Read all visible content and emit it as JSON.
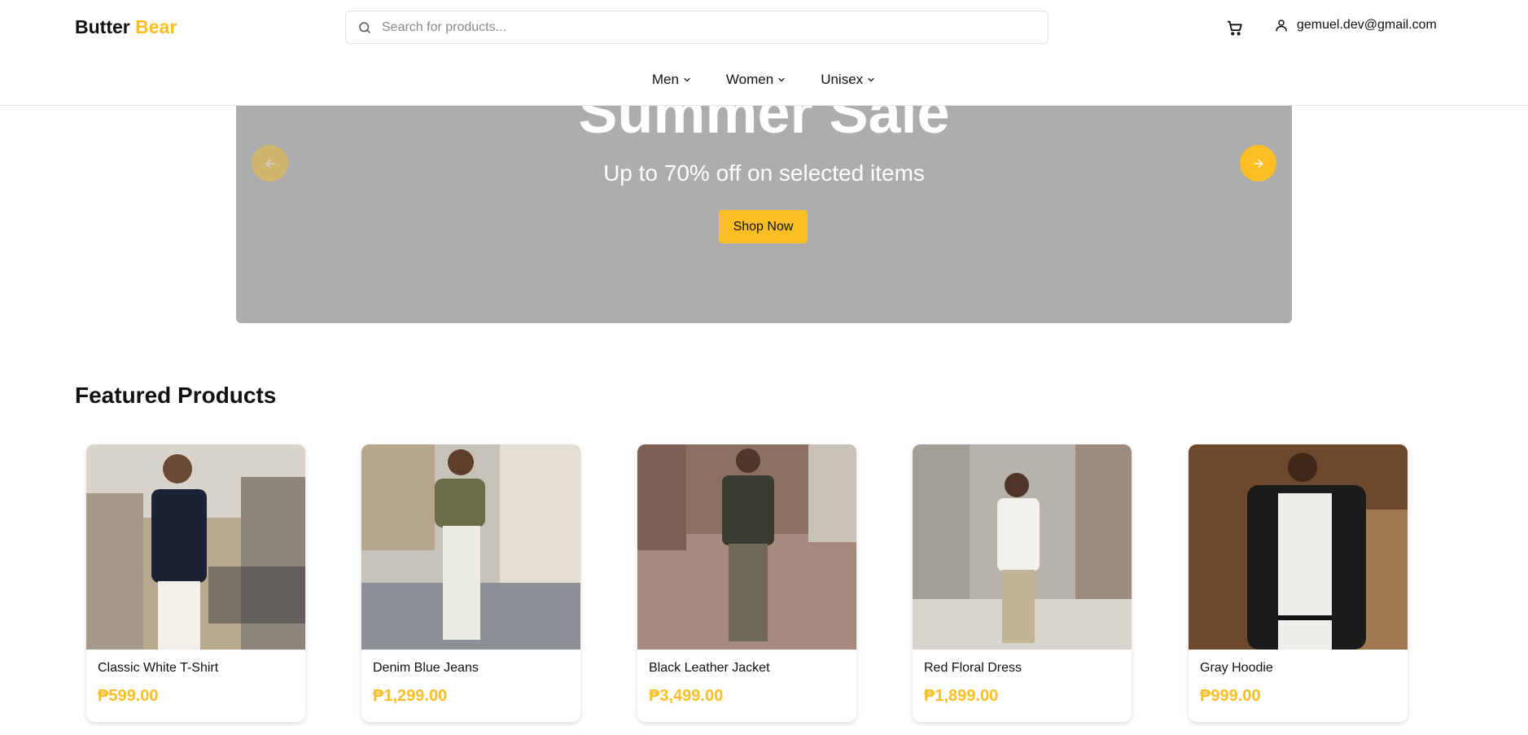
{
  "brand": {
    "name_part1": "Butter",
    "name_part2": "Bear",
    "accent_color": "#fbbf24"
  },
  "search": {
    "placeholder": "Search for products...",
    "icon": "search-icon"
  },
  "user": {
    "email": "gemuel.dev@gmail.com",
    "icon": "user-icon"
  },
  "cart": {
    "icon": "cart-icon"
  },
  "nav": {
    "items": [
      {
        "label": "Men"
      },
      {
        "label": "Women"
      },
      {
        "label": "Unisex"
      }
    ]
  },
  "hero": {
    "title": "Summer Sale",
    "subtitle": "Up to 70% off on selected items",
    "cta_label": "Shop Now",
    "background": "#adadad"
  },
  "featured": {
    "title": "Featured Products",
    "products": [
      {
        "name": "Classic White T-Shirt",
        "price": "₱599.00"
      },
      {
        "name": "Denim Blue Jeans",
        "price": "₱1,299.00"
      },
      {
        "name": "Black Leather Jacket",
        "price": "₱3,499.00"
      },
      {
        "name": "Red Floral Dress",
        "price": "₱1,899.00"
      },
      {
        "name": "Gray Hoodie",
        "price": "₱999.00"
      }
    ]
  }
}
